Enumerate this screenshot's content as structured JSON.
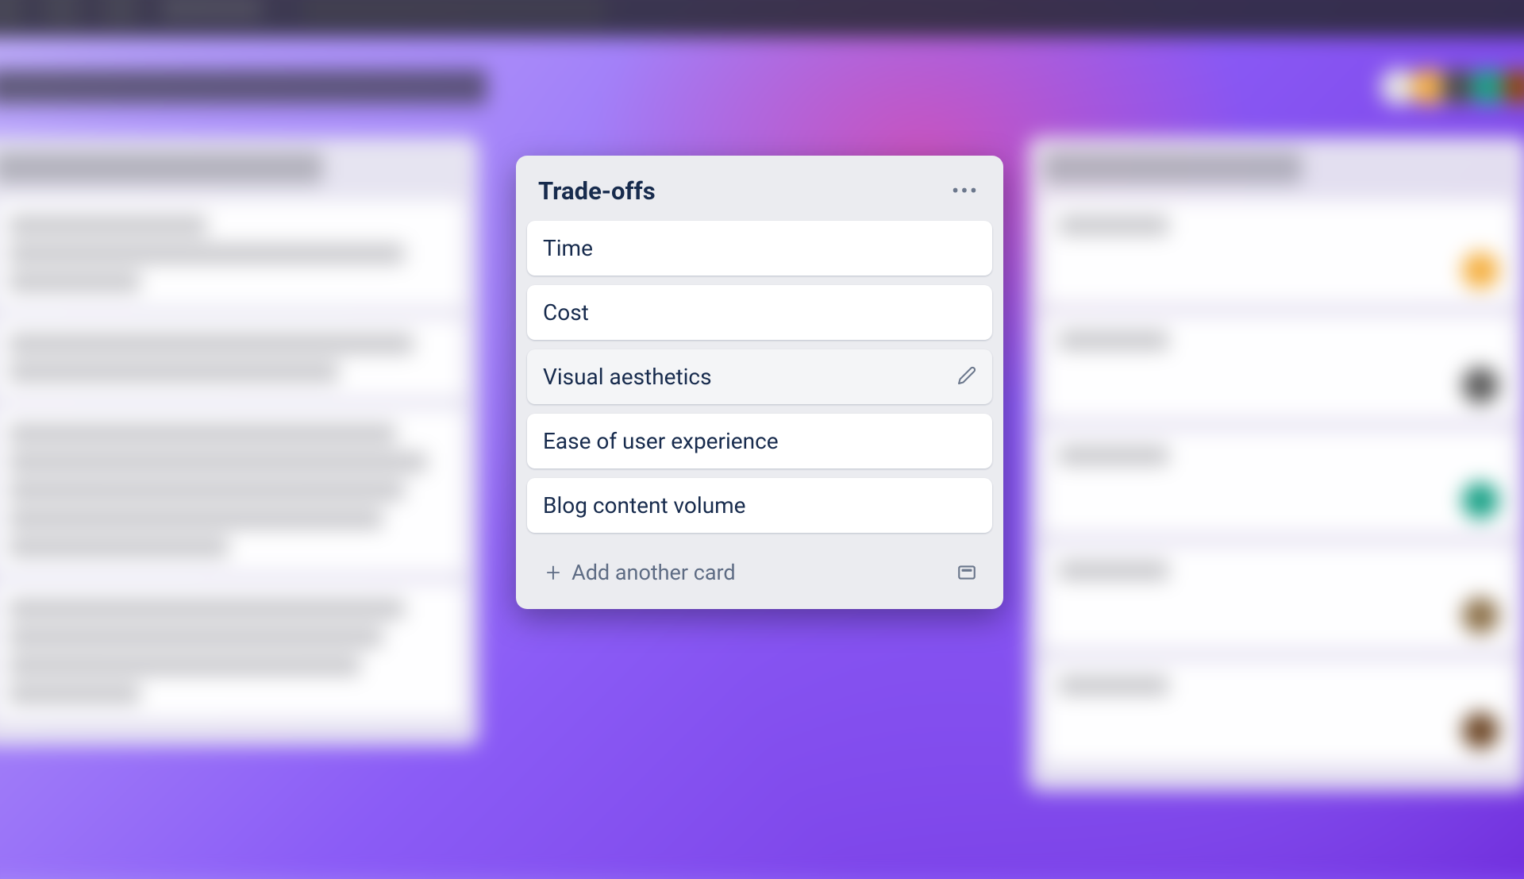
{
  "focused_list": {
    "title": "Trade-offs",
    "cards": [
      {
        "title": "Time",
        "hovered": false
      },
      {
        "title": "Cost",
        "hovered": false
      },
      {
        "title": "Visual aesthetics",
        "hovered": true
      },
      {
        "title": "Ease of user experience",
        "hovered": false
      },
      {
        "title": "Blog content volume",
        "hovered": false
      }
    ],
    "add_card_label": "Add another card"
  },
  "bg": {
    "avatars": [
      "#e5e5e5",
      "#f5b041",
      "#4a4a4a",
      "#16a085",
      "#8b4513"
    ],
    "right_avatars": [
      "#f5b041",
      "#5a5a5a",
      "#16a085",
      "#8b6f47",
      "#6b4423"
    ]
  }
}
